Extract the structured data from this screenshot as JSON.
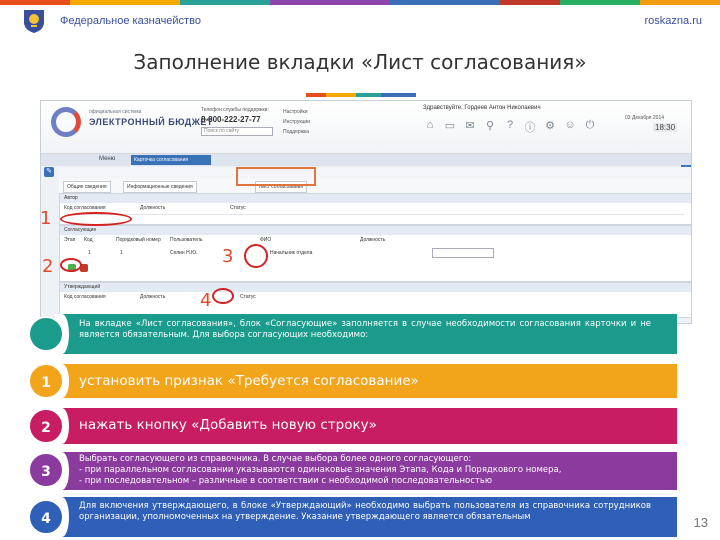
{
  "header": {
    "org": "Федеральное казначейство",
    "site": "roskazna.ru",
    "stripe_colors": [
      "#e84e1b",
      "#f2a900",
      "#2aa198",
      "#8e44ad",
      "#3a6fb7",
      "#c0392b",
      "#27ae60",
      "#f39c12"
    ]
  },
  "title": "Заполнение вкладки «Лист согласования»",
  "screenshot": {
    "logo_small": "официальная система",
    "logo_text": "ЭЛЕКТРОННЫЙ БЮДЖЕТ",
    "phone_label": "Телефон службы поддержки:",
    "phone": "8-800-222-27-77",
    "search_placeholder": "Поиск по сайту",
    "header_links": [
      "Настройки",
      "Инструкции",
      "Поддержка"
    ],
    "user": "Здравствуйте, Гордеев Антон Николаевич",
    "date": "03 Декабря 2014",
    "clock": "18:30",
    "menu_label": "Меню",
    "active_tab": "Карточка согласования",
    "tabs": [
      "Общие сведения",
      "Информационные сведения",
      "Лист согласования"
    ],
    "panel1_title": "Автор",
    "panel1_cols": [
      "Код согласования",
      "Должность",
      "Статус"
    ],
    "panel2_title": "Согласующие",
    "panel2_cols": [
      "Этап",
      "Код",
      "Порядковый номер",
      "Пользователь",
      "ФИО",
      "Должность"
    ],
    "panel2_row": [
      "1",
      "1",
      "Селин Н.Ю.",
      "Начальник отдела"
    ],
    "panel3_title": "Утверждающий",
    "panel3_cols": [
      "Код согласования",
      "Должность",
      "Статус"
    ],
    "annotations": [
      "1",
      "2",
      "3",
      "4"
    ]
  },
  "steps": [
    {
      "badge": "",
      "text": "На вкладке «Лист согласования», блок «Согласующие» заполняется в случае необходимости согласования карточки и не является обязательным. Для выбора согласующих необходимо:",
      "color": "#1a9b8c"
    },
    {
      "badge": "1",
      "text": "установить признак «Требуется согласование»",
      "color": "#f2a51a"
    },
    {
      "badge": "2",
      "text": "нажать кнопку «Добавить новую строку»",
      "color": "#c81d63"
    },
    {
      "badge": "3",
      "text": "Выбрать согласующего из справочника. В случае выбора более одного согласующего:\n- при параллельном согласовании указываются одинаковые значения Этапа, Кода и Порядкового номера,\n- при последовательном – различные в соответствии с необходимой последовательностью",
      "color": "#8b3a9e"
    },
    {
      "badge": "4",
      "text": "Для включения утверждающего, в блоке «Утверждающий» необходимо выбрать пользователя из справочника сотрудников организации, уполномоченных на утверждение. Указание утверждающего является обязательным",
      "color": "#2f5fb7"
    }
  ],
  "page_number": "13"
}
